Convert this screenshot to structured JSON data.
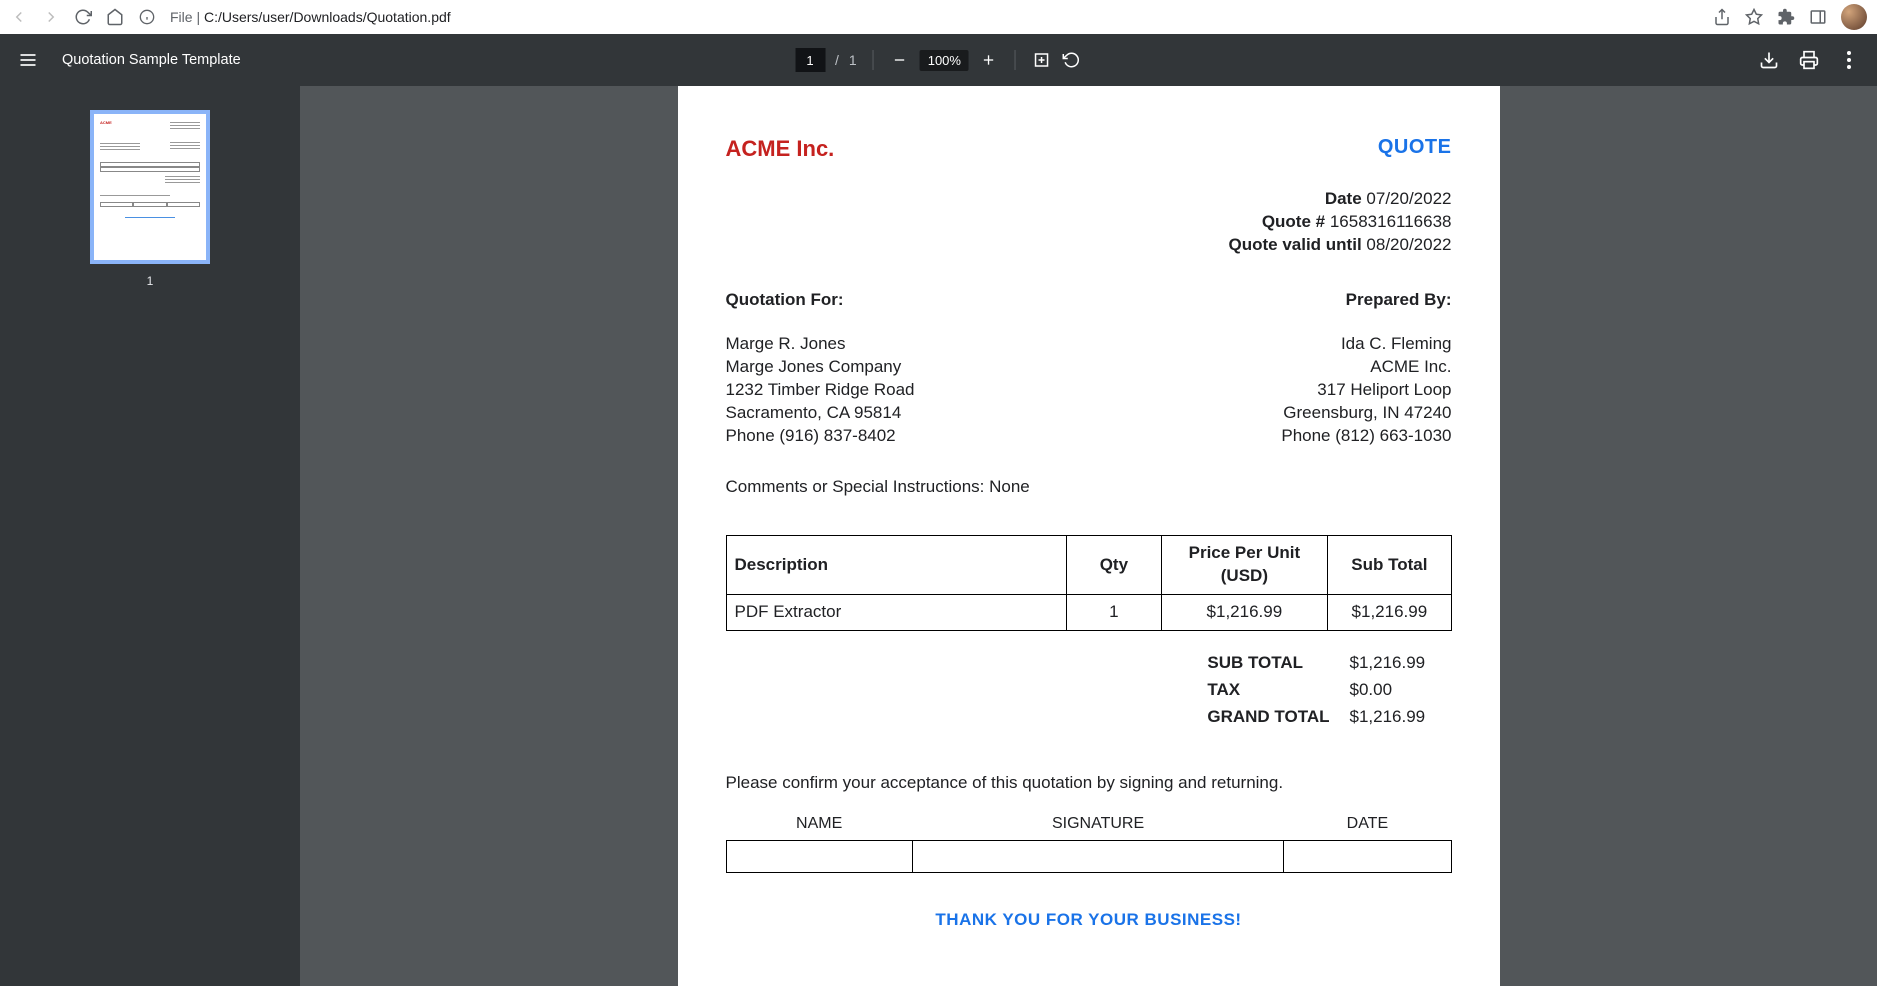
{
  "browser": {
    "url_prefix": "File |",
    "url_path": "C:/Users/user/Downloads/Quotation.pdf"
  },
  "viewer": {
    "title": "Quotation Sample Template",
    "page_current": "1",
    "page_sep": "/",
    "page_total": "1",
    "zoom": "100%",
    "thumb_label": "1"
  },
  "doc": {
    "company": "ACME Inc.",
    "quote_label": "QUOTE",
    "meta": {
      "date_label": "Date",
      "date": "07/20/2022",
      "quote_num_label": "Quote #",
      "quote_num": "1658316116638",
      "valid_label": "Quote valid until",
      "valid": "08/20/2022"
    },
    "for_label": "Quotation For:",
    "by_label": "Prepared By:",
    "for": {
      "name": "Marge R. Jones",
      "company": "Marge Jones Company",
      "street": "1232 Timber Ridge Road",
      "city": "Sacramento, CA 95814",
      "phone": "Phone (916) 837-8402"
    },
    "by": {
      "name": "Ida C. Fleming",
      "company": "ACME Inc.",
      "street": "317 Heliport Loop",
      "city": "Greensburg, IN 47240",
      "phone": "Phone (812) 663-1030"
    },
    "comments_label": "Comments or Special Instructions:",
    "comments_value": "None",
    "table": {
      "headers": {
        "desc": "Description",
        "qty": "Qty",
        "ppu": "Price Per Unit (USD)",
        "sub": "Sub Total"
      },
      "row": {
        "desc": "PDF Extractor",
        "qty": "1",
        "ppu": "$1,216.99",
        "sub": "$1,216.99"
      }
    },
    "totals": {
      "sub_label": "SUB TOTAL",
      "sub": "$1,216.99",
      "tax_label": "TAX",
      "tax": "$0.00",
      "grand_label": "GRAND TOTAL",
      "grand": "$1,216.99"
    },
    "confirm": "Please confirm your acceptance of this quotation by signing and returning.",
    "sign": {
      "name": "NAME",
      "sig": "SIGNATURE",
      "date": "DATE"
    },
    "thankyou": "THANK YOU FOR YOUR BUSINESS!"
  }
}
